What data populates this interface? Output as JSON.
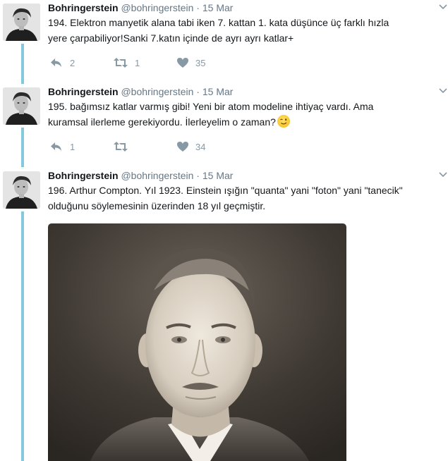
{
  "colors": {
    "thread_line": "#83c9dd",
    "name": "#14171a",
    "meta": "#657786",
    "action": "#8899a6"
  },
  "tweets": [
    {
      "name": "Bohringerstein",
      "handle": "@bohringerstein",
      "dot": "·",
      "date": "15 Mar",
      "line1": "194. Elektron manyetik alana tabi iken 7. kattan 1. kata düşünce üç farklı hızla",
      "line2": "yere çarpabiliyor!Sanki 7.katın içinde de ayrı ayrı katlar+",
      "reply_count": "2",
      "retweet_count": "1",
      "like_count": "35"
    },
    {
      "name": "Bohringerstein",
      "handle": "@bohringerstein",
      "dot": "·",
      "date": "15 Mar",
      "line1": "195. bağımsız katlar varmış gibi! Yeni bir atom modeline ihtiyaç vardı. Ama",
      "line2": "kuramsal ilerleme gerekiyordu. İlerleyelim o zaman?",
      "emoji": "winking-face",
      "reply_count": "1",
      "retweet_count": "",
      "like_count": "34"
    },
    {
      "name": "Bohringerstein",
      "handle": "@bohringerstein",
      "dot": "·",
      "date": "15 Mar",
      "line1": "196. Arthur Compton. Yıl 1923. Einstein ışığın \"quanta\" yani \"foton\" yani \"tanecik\"",
      "line2": "olduğunu söylemesinin üzerinden 18 yıl geçmiştir.",
      "media": "portrait-photo"
    }
  ],
  "icons": [
    "reply-icon",
    "retweet-icon",
    "like-icon",
    "chevron-down-icon"
  ]
}
